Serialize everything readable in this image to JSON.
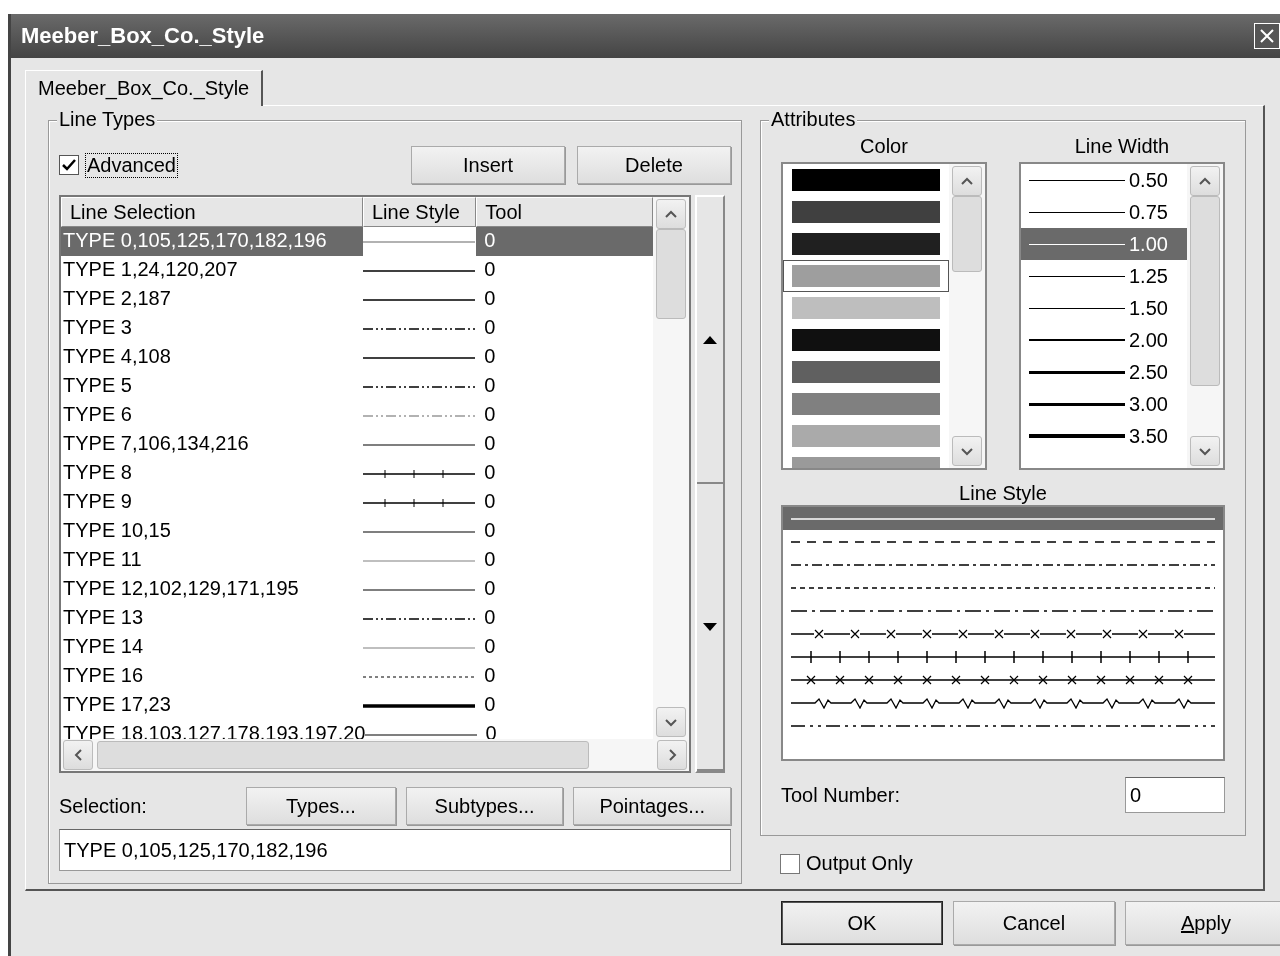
{
  "window": {
    "title": "Meeber_Box_Co._Style"
  },
  "tabs": [
    {
      "label": "Meeber_Box_Co._Style",
      "selected": true
    }
  ],
  "line_types": {
    "title": "Line Types",
    "advanced": {
      "label": "Advanced",
      "checked": true
    },
    "buttons": [
      "Insert",
      "Delete"
    ],
    "table": {
      "columns": [
        "Line Selection",
        "Line Style",
        "Tool"
      ],
      "rows": [
        {
          "selection": "TYPE 0,105,125,170,182,196",
          "kind": "light",
          "tool": "0",
          "selected": true
        },
        {
          "selection": "TYPE 1,24,120,207",
          "kind": "solid",
          "tool": "0",
          "selected": false
        },
        {
          "selection": "TYPE 2,187",
          "kind": "solid",
          "tool": "0",
          "selected": false
        },
        {
          "selection": "TYPE 3",
          "kind": "dash-dot",
          "tool": "0",
          "selected": false
        },
        {
          "selection": "TYPE 4,108",
          "kind": "solid",
          "tool": "0",
          "selected": false
        },
        {
          "selection": "TYPE 5",
          "kind": "dash-dot",
          "tool": "0",
          "selected": false
        },
        {
          "selection": "TYPE 6",
          "kind": "dash-dot-light",
          "tool": "0",
          "selected": false
        },
        {
          "selection": "TYPE 7,106,134,216",
          "kind": "gray",
          "tool": "0",
          "selected": false
        },
        {
          "selection": "TYPE 8",
          "kind": "ticks",
          "tool": "0",
          "selected": false
        },
        {
          "selection": "TYPE 9",
          "kind": "ticks",
          "tool": "0",
          "selected": false
        },
        {
          "selection": "TYPE 10,15",
          "kind": "gray",
          "tool": "0",
          "selected": false
        },
        {
          "selection": "TYPE 11",
          "kind": "light",
          "tool": "0",
          "selected": false
        },
        {
          "selection": "TYPE 12,102,129,171,195",
          "kind": "gray",
          "tool": "0",
          "selected": false
        },
        {
          "selection": "TYPE 13",
          "kind": "dash-dot",
          "tool": "0",
          "selected": false
        },
        {
          "selection": "TYPE 14",
          "kind": "light",
          "tool": "0",
          "selected": false
        },
        {
          "selection": "TYPE 16",
          "kind": "dotted",
          "tool": "0",
          "selected": false
        },
        {
          "selection": "TYPE 17,23",
          "kind": "thick",
          "tool": "0",
          "selected": false
        },
        {
          "selection": "TYPE 18.103.127.178.193.197.20",
          "kind": "gray",
          "tool": "0",
          "selected": false
        }
      ]
    },
    "selection_label": "Selection:",
    "selection_buttons": [
      "Types...",
      "Subtypes...",
      "Pointages..."
    ],
    "selection_value": "TYPE 0,105,125,170,182,196"
  },
  "attributes": {
    "title": "Attributes",
    "color_label": "Color",
    "colors": [
      {
        "color": "#000000",
        "selected": false
      },
      {
        "color": "#404040",
        "selected": false
      },
      {
        "color": "#202020",
        "selected": false
      },
      {
        "color": "#9e9e9e",
        "selected": true
      },
      {
        "color": "#bebebe",
        "selected": false
      },
      {
        "color": "#101010",
        "selected": false
      },
      {
        "color": "#606060",
        "selected": false
      },
      {
        "color": "#808080",
        "selected": false
      },
      {
        "color": "#aaaaaa",
        "selected": false
      },
      {
        "color": "#9a9a9a",
        "selected": false
      }
    ],
    "width_label": "Line Width",
    "widths": [
      {
        "label": "0.50",
        "selected": false
      },
      {
        "label": "0.75",
        "selected": false
      },
      {
        "label": "1.00",
        "selected": true
      },
      {
        "label": "1.25",
        "selected": false
      },
      {
        "label": "1.50",
        "selected": false
      },
      {
        "label": "2.00",
        "selected": false
      },
      {
        "label": "2.50",
        "selected": false
      },
      {
        "label": "3.00",
        "selected": false
      },
      {
        "label": "3.50",
        "selected": false
      }
    ],
    "style_label": "Line Style",
    "styles": [
      {
        "kind": "solid",
        "selected": true
      },
      {
        "kind": "dashed",
        "selected": false
      },
      {
        "kind": "dash-dot",
        "selected": false
      },
      {
        "kind": "dotted",
        "selected": false
      },
      {
        "kind": "long-dash-dot",
        "selected": false
      },
      {
        "kind": "x-line",
        "selected": false
      },
      {
        "kind": "tick-line",
        "selected": false
      },
      {
        "kind": "cross-line",
        "selected": false
      },
      {
        "kind": "zigzag",
        "selected": false
      },
      {
        "kind": "dash-dot-dot",
        "selected": false
      }
    ],
    "tool_label": "Tool Number:",
    "tool_value": "0"
  },
  "output_only": {
    "label": "Output Only",
    "checked": false
  },
  "footer_buttons": [
    {
      "label": "OK",
      "default": true,
      "mnemonic": false
    },
    {
      "label": "Cancel",
      "default": false,
      "mnemonic": false
    },
    {
      "label": "Apply",
      "default": false,
      "mnemonic": true
    }
  ]
}
